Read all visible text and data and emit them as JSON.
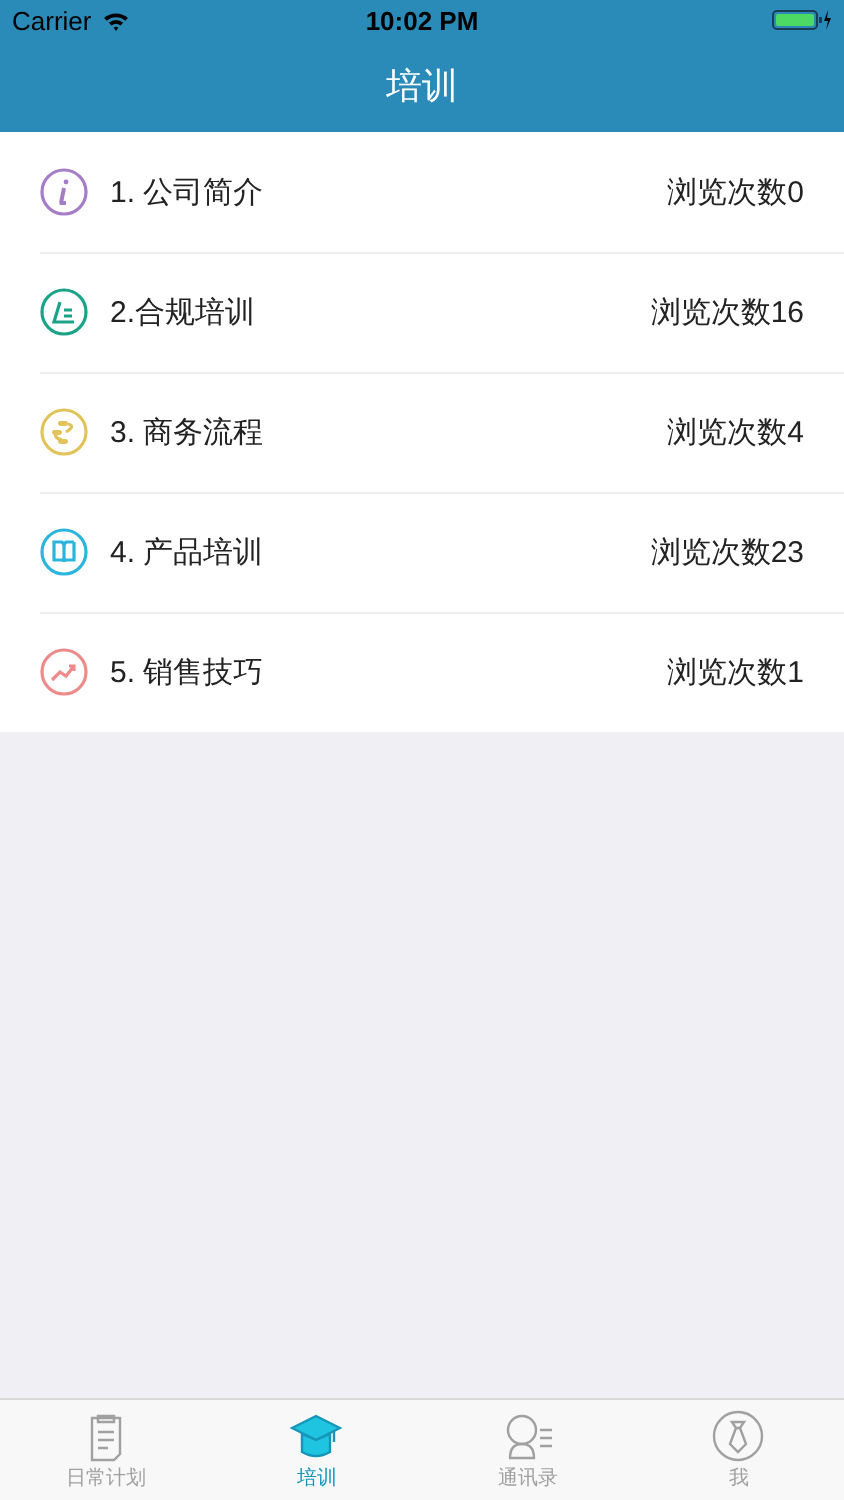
{
  "status_bar": {
    "carrier": "Carrier",
    "time": "10:02 PM"
  },
  "nav": {
    "title": "培训"
  },
  "items": [
    {
      "title": "1. 公司简介",
      "views": "浏览次数0",
      "color": "#a57cc6"
    },
    {
      "title": "2.合规培训",
      "views": "浏览次数16",
      "color": "#1aa386"
    },
    {
      "title": "3. 商务流程",
      "views": "浏览次数4",
      "color": "#e0c35a"
    },
    {
      "title": "4. 产品培训",
      "views": "浏览次数23",
      "color": "#2bb5dc"
    },
    {
      "title": "5. 销售技巧",
      "views": "浏览次数1",
      "color": "#ef8a8a"
    }
  ],
  "tabs": [
    {
      "label": "日常计划",
      "selected": false
    },
    {
      "label": "培训",
      "selected": true
    },
    {
      "label": "通讯录",
      "selected": false
    },
    {
      "label": "我",
      "selected": false
    }
  ]
}
